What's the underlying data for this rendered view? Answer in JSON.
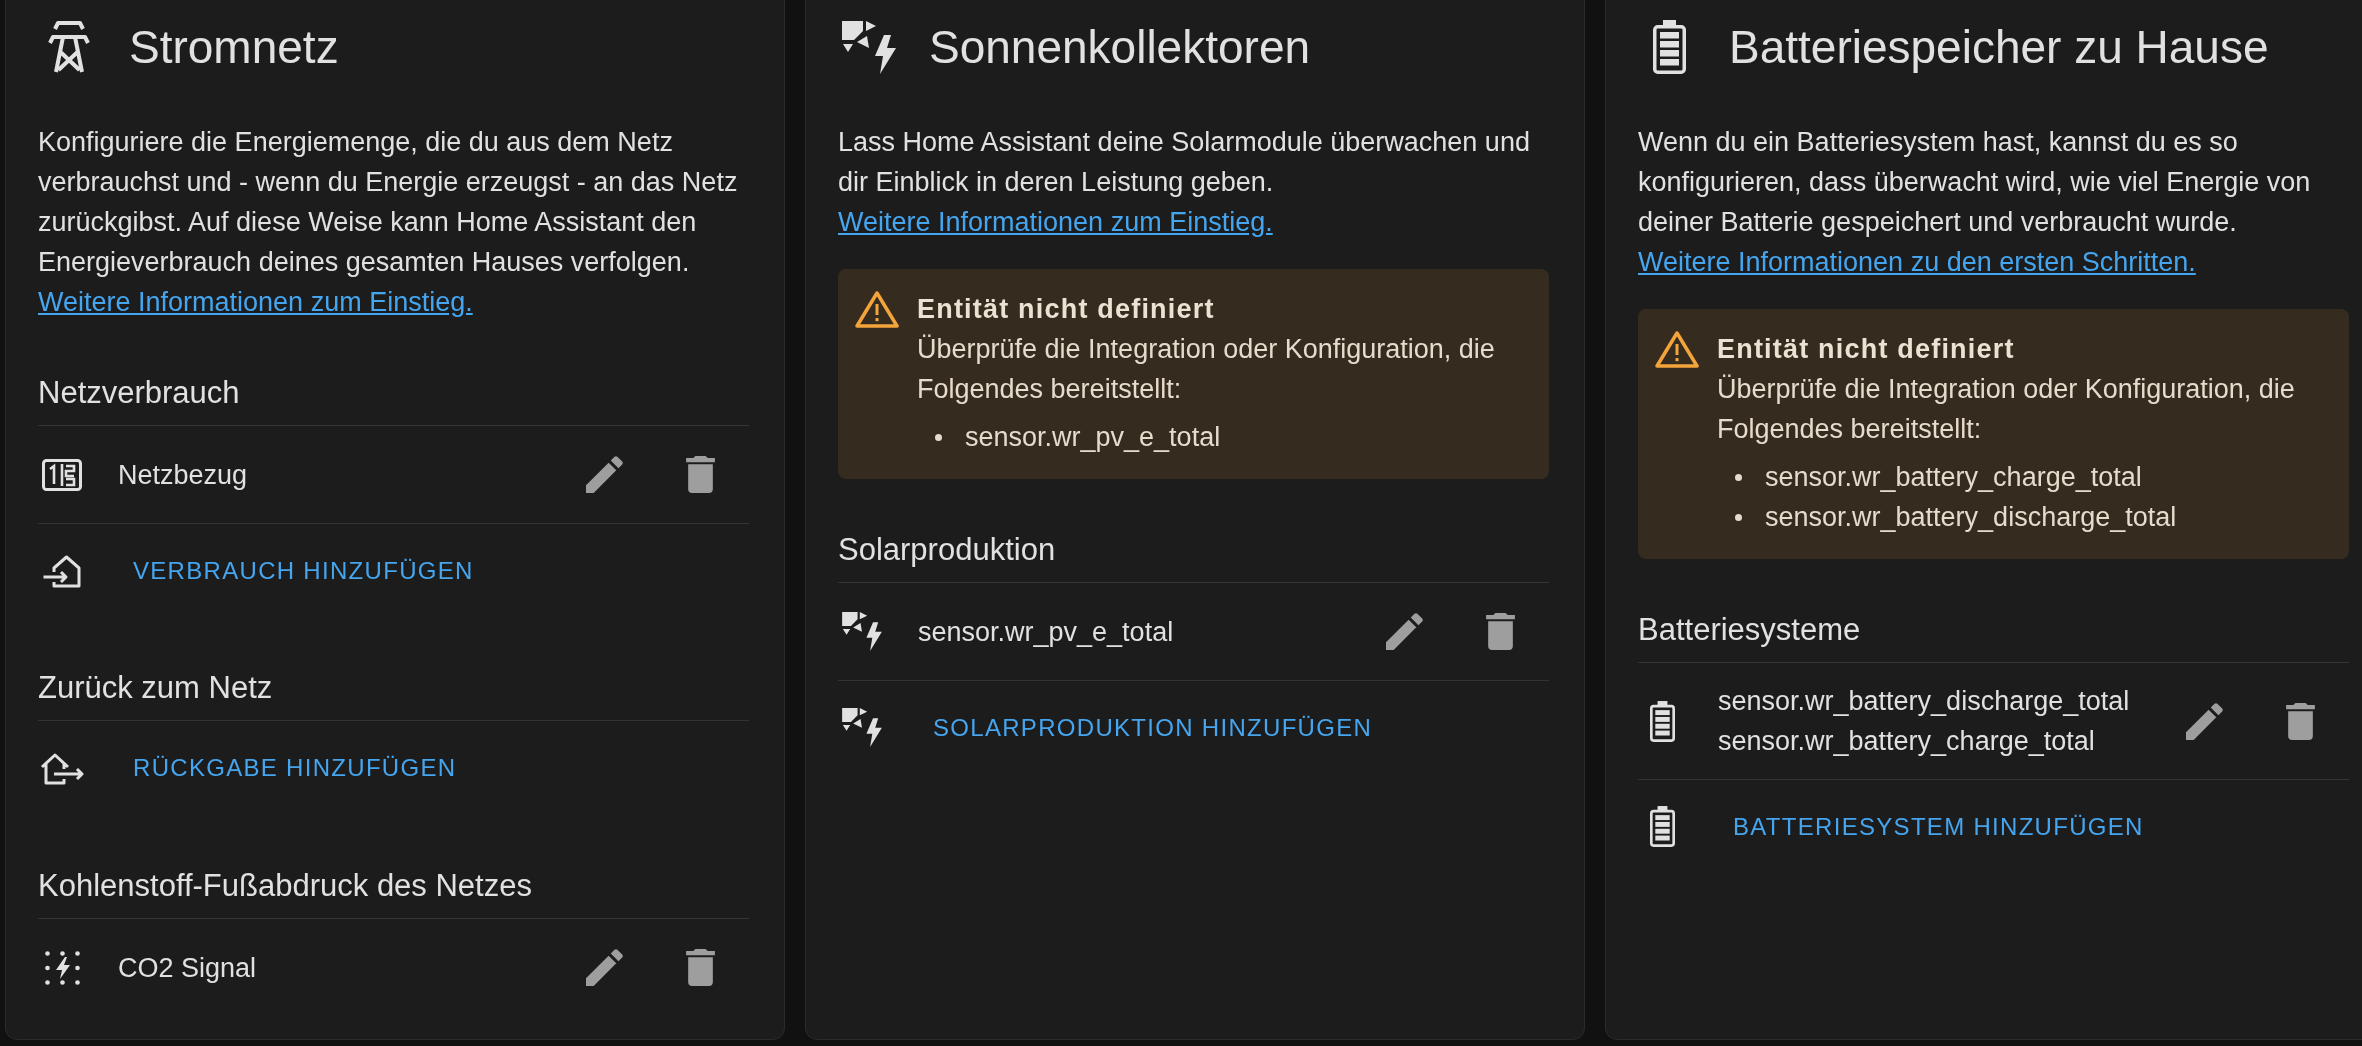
{
  "cards": [
    {
      "kind": "grid",
      "title": "Stromnetz",
      "description": "Konfiguriere die Energiemenge, die du aus dem Netz verbrauchst und - wenn du Energie erzeugst - an das Netz zurückgibst. Auf diese Weise kann Home Assistant den Energieverbrauch deines gesamten Hauses verfolgen.",
      "link": "Weitere Informationen zum Einstieg.",
      "sections": [
        {
          "kind": "grid_consumption",
          "heading": "Netzverbrauch",
          "items": [
            {
              "lines": [
                "Netzbezug"
              ]
            }
          ],
          "add_label": "VERBRAUCH HINZUFÜGEN"
        },
        {
          "kind": "grid_return",
          "heading": "Zurück zum Netz",
          "add_label": "RÜCKGABE HINZUFÜGEN"
        },
        {
          "kind": "co2",
          "heading": "Kohlenstoff-Fußabdruck des Netzes",
          "items": [
            {
              "lines": [
                "CO2 Signal"
              ]
            }
          ]
        }
      ]
    },
    {
      "kind": "solar",
      "title": "Sonnenkollektoren",
      "description": "Lass Home Assistant deine Solarmodule überwachen und dir Einblick in deren Leistung geben.",
      "link": "Weitere Informationen zum Einstieg.",
      "warning": {
        "title": "Entität nicht definiert",
        "message": "Überprüfe die Integration oder Konfiguration, die Folgendes bereitstellt:",
        "entities": [
          "sensor.wr_pv_e_total"
        ]
      },
      "sections": [
        {
          "kind": "solar_production",
          "heading": "Solarproduktion",
          "items": [
            {
              "lines": [
                "sensor.wr_pv_e_total"
              ]
            }
          ],
          "add_label": "SOLARPRODUKTION HINZUFÜGEN"
        }
      ]
    },
    {
      "kind": "battery",
      "title": "Batteriespeicher zu Hause",
      "description": "Wenn du ein Batteriesystem hast, kannst du es so konfigurieren, dass überwacht wird, wie viel Energie von deiner Batterie gespeichert und verbraucht wurde.",
      "link": "Weitere Informationen zu den ersten Schritten.",
      "warning": {
        "title": "Entität nicht definiert",
        "message": "Überprüfe die Integration oder Konfiguration, die Folgendes bereitstellt:",
        "entities": [
          "sensor.wr_battery_charge_total",
          "sensor.wr_battery_discharge_total"
        ]
      },
      "sections": [
        {
          "kind": "battery_systems",
          "heading": "Batteriesysteme",
          "items": [
            {
              "lines": [
                "sensor.wr_battery_discharge_total",
                "sensor.wr_battery_charge_total"
              ]
            }
          ],
          "add_label": "BATTERIESYSTEM HINZUFÜGEN"
        }
      ]
    }
  ]
}
